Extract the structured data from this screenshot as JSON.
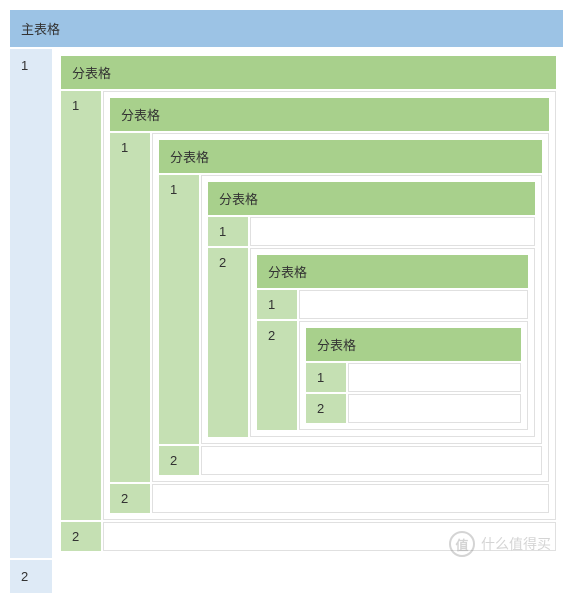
{
  "main": {
    "header": "主表格",
    "rows": [
      "1",
      "2"
    ]
  },
  "sub": {
    "header": "分表格",
    "rows": [
      "1",
      "2"
    ]
  },
  "watermark": {
    "icon": "值",
    "text": "什么值得买"
  }
}
